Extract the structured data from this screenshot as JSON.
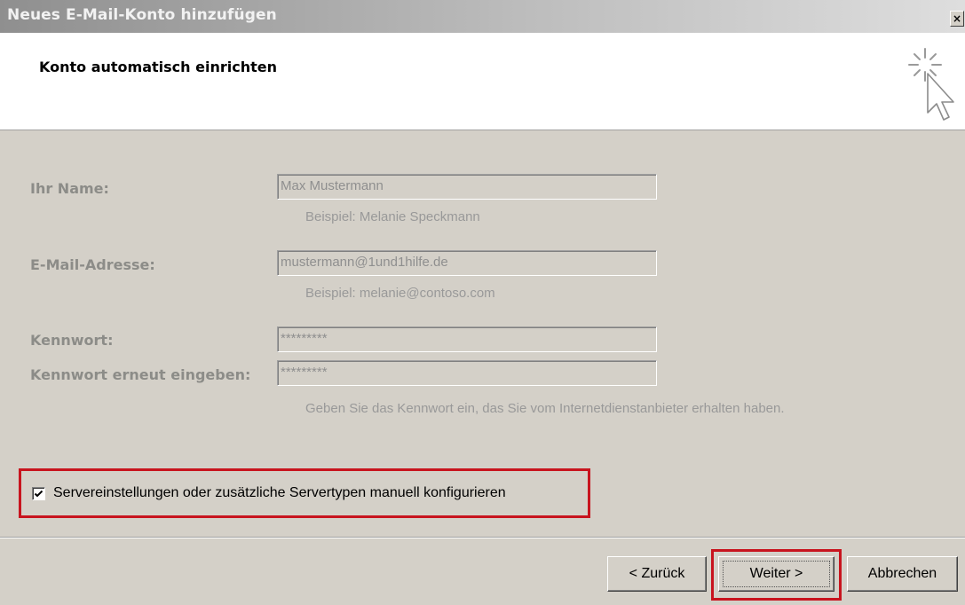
{
  "window": {
    "title": "Neues E-Mail-Konto hinzufügen",
    "close_glyph": "×"
  },
  "header": {
    "heading": "Konto automatisch einrichten",
    "icon": "wizard-cursor-icon"
  },
  "form": {
    "name_label": "Ihr Name:",
    "name_value": "Max Mustermann",
    "name_hint": "Beispiel: Melanie Speckmann",
    "email_label": "E-Mail-Adresse:",
    "email_value": "mustermann@1und1hilfe.de",
    "email_hint": "Beispiel: melanie@contoso.com",
    "password_label": "Kennwort:",
    "password_value": "*********",
    "password_confirm_label": "Kennwort erneut eingeben:",
    "password_confirm_value": "*********",
    "password_hint": "Geben Sie das Kennwort ein, das Sie vom Internetdienstanbieter erhalten haben."
  },
  "manual_config": {
    "label": "Servereinstellungen oder zusätzliche Servertypen manuell konfigurieren",
    "checked": true
  },
  "buttons": {
    "back": "< Zurück",
    "next": "Weiter >",
    "cancel": "Abbrechen"
  },
  "colors": {
    "highlight": "#c8141e",
    "dialog_bg": "#d4d0c8",
    "disabled_text": "#8c8c88"
  }
}
